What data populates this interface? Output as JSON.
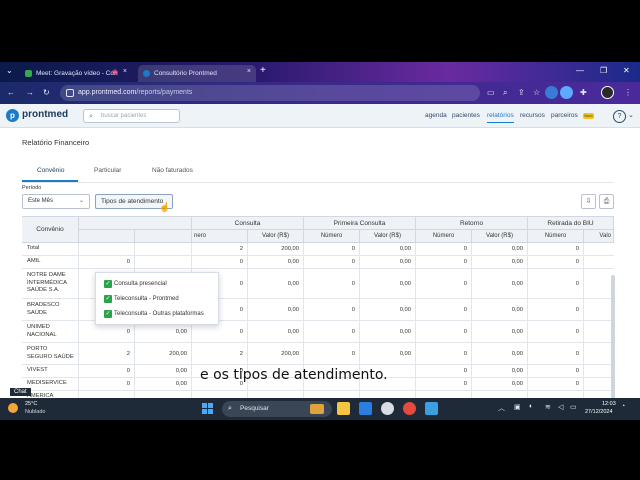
{
  "browser": {
    "tabs": [
      {
        "title": "Meet: Gravação vídeo - Con"
      },
      {
        "title": "Consultório Prontmed"
      }
    ],
    "url_host": "app.prontmed.com",
    "url_path": "/reports/payments"
  },
  "app": {
    "logo": "prontmed",
    "search_placeholder": "buscar pacientes",
    "nav": [
      "agenda",
      "pacientes",
      "relatórios",
      "recursos",
      "parceiros"
    ],
    "nav_badge": "Novo",
    "help": "?"
  },
  "page": {
    "title": "Relatório Financeiro",
    "subtabs": [
      "Convênio",
      "Particular",
      "Não faturados"
    ],
    "period_label": "Período",
    "period_value": "Este Mês",
    "types_button": "Tipos de atendimento"
  },
  "popup": {
    "options": [
      "Consulta presencial",
      "Teleconsulta - Prontmed",
      "Teleconsulta - Outras plataformas"
    ],
    "check_glyph": "✓"
  },
  "table": {
    "header_top": [
      "Convênio",
      "Consulta",
      "Primeira Consulta",
      "Retorno",
      "Retirada do BIU"
    ],
    "partial_header_a": "nero",
    "partial_header_b": "Valo",
    "sub_numero": "Número",
    "sub_valor": "Valor (R$)",
    "rows": [
      {
        "name": "Total",
        "c1": "",
        "c2": "",
        "n1": "2",
        "v1": "200,00",
        "n2": "0",
        "v2": "0,00",
        "n3": "0",
        "v3": "0,00",
        "n4": "0"
      },
      {
        "name": "AMIL",
        "c1": "0",
        "c2": "",
        "n1": "0",
        "v1": "0,00",
        "n2": "0",
        "v2": "0,00",
        "n3": "0",
        "v3": "0,00",
        "n4": "0"
      },
      {
        "name": "NOTRE DAME INTERMÉDICA SAÚDE S.A.",
        "c1": "0",
        "c2": "0,00",
        "n1": "0",
        "v1": "0,00",
        "n2": "0",
        "v2": "0,00",
        "n3": "0",
        "v3": "0,00",
        "n4": "0"
      },
      {
        "name": "BRADESCO SAÚDE",
        "c1": "0",
        "c2": "0,00",
        "n1": "0",
        "v1": "0,00",
        "n2": "0",
        "v2": "0,00",
        "n3": "0",
        "v3": "0,00",
        "n4": "0"
      },
      {
        "name": "UNIMED NACIONAL",
        "c1": "0",
        "c2": "0,00",
        "n1": "0",
        "v1": "0,00",
        "n2": "0",
        "v2": "0,00",
        "n3": "0",
        "v3": "0,00",
        "n4": "0"
      },
      {
        "name": "PORTO SEGURO SAÚDE",
        "c1": "2",
        "c2": "200,00",
        "n1": "2",
        "v1": "200,00",
        "n2": "0",
        "v2": "0,00",
        "n3": "0",
        "v3": "0,00",
        "n4": "0"
      },
      {
        "name": "VIVEST",
        "c1": "0",
        "c2": "0,00",
        "n1": "0",
        "v1": "",
        "n2": "",
        "v2": "",
        "n3": "0",
        "v3": "0,00",
        "n4": "0"
      },
      {
        "name": "MEDISERVICE",
        "c1": "0",
        "c2": "0,00",
        "n1": "0",
        "v1": "",
        "n2": "",
        "v2": "",
        "n3": "0",
        "v3": "0,00",
        "n4": "0"
      },
      {
        "name": "AMERICA",
        "c1": "",
        "c2": "",
        "n1": "",
        "v1": "",
        "n2": "",
        "v2": "",
        "n3": "",
        "v3": "",
        "n4": ""
      }
    ]
  },
  "caption": "e os tipos de atendimento.",
  "taskbar": {
    "chat": "Chat",
    "temp": "25°C",
    "weather": "Nublado",
    "search": "Pesquisar",
    "time": "12:03",
    "date": "27/12/2024"
  },
  "colors": {
    "accent": "#1b7bc7",
    "check": "#2aa44b",
    "badge": "#f4c21b"
  }
}
